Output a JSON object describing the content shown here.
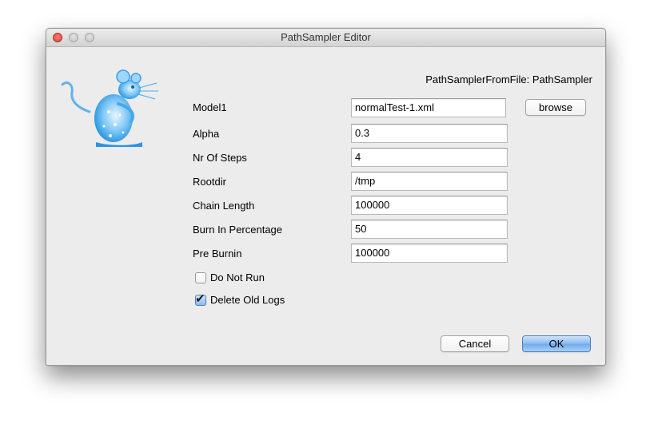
{
  "window": {
    "title": "PathSampler Editor"
  },
  "header": {
    "label": "PathSamplerFromFile: PathSampler"
  },
  "fields": {
    "model1": {
      "label": "Model1",
      "value": "normalTest-1.xml"
    },
    "alpha": {
      "label": "Alpha",
      "value": "0.3"
    },
    "nr_of_steps": {
      "label": "Nr Of Steps",
      "value": "4"
    },
    "rootdir": {
      "label": "Rootdir",
      "value": "/tmp"
    },
    "chain_length": {
      "label": "Chain Length",
      "value": "100000"
    },
    "burn_in_percentage": {
      "label": "Burn In Percentage",
      "value": "50"
    },
    "pre_burnin": {
      "label": "Pre Burnin",
      "value": "100000"
    }
  },
  "browse_button": {
    "label": "browse"
  },
  "options": {
    "do_not_run": {
      "label": "Do Not Run",
      "checked": false
    },
    "delete_old_logs": {
      "label": "Delete Old Logs",
      "checked": true
    }
  },
  "buttons": {
    "cancel": "Cancel",
    "ok": "OK"
  },
  "colors": {
    "accent": "#6fa8ec",
    "logo": "#3aa0e8",
    "close": "#fc605c"
  }
}
